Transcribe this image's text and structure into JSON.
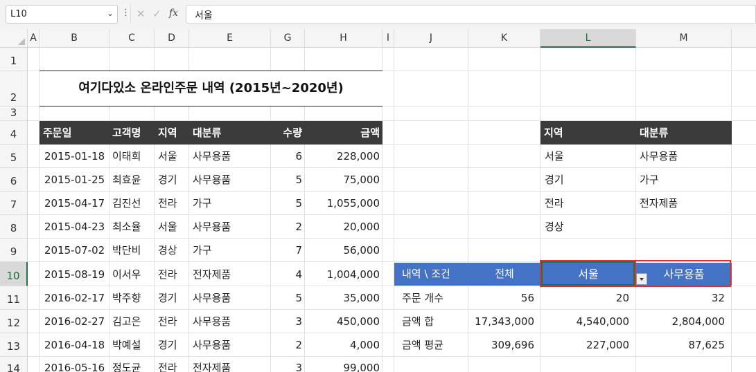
{
  "formula_bar": {
    "name_box": "L10",
    "fx_label": "fx",
    "formula": "서울"
  },
  "columns": [
    {
      "label": "A"
    },
    {
      "label": "B"
    },
    {
      "label": "C"
    },
    {
      "label": "D"
    },
    {
      "label": "E"
    },
    {
      "label": "G"
    },
    {
      "label": "H"
    },
    {
      "label": "I"
    },
    {
      "label": "J"
    },
    {
      "label": "K"
    },
    {
      "label": "L"
    },
    {
      "label": "M"
    }
  ],
  "rows": [
    "1",
    "2",
    "3",
    "4",
    "5",
    "6",
    "7",
    "8",
    "9",
    "10",
    "11",
    "12",
    "13",
    "14"
  ],
  "title": "여기다있소 온라인주문 내역 (2015년~2020년)",
  "orders": {
    "headers": [
      "주문일",
      "고객명",
      "지역",
      "대분류",
      "수량",
      "금액"
    ],
    "rows": [
      [
        "2015-01-18",
        "이태희",
        "서울",
        "사무용품",
        "6",
        "228,000"
      ],
      [
        "2015-01-25",
        "최효윤",
        "경기",
        "사무용품",
        "5",
        "75,000"
      ],
      [
        "2015-04-17",
        "김진선",
        "전라",
        "가구",
        "5",
        "1,055,000"
      ],
      [
        "2015-04-23",
        "최소율",
        "서울",
        "사무용품",
        "2",
        "20,000"
      ],
      [
        "2015-07-02",
        "박단비",
        "경상",
        "가구",
        "7",
        "56,000"
      ],
      [
        "2015-08-19",
        "이서우",
        "전라",
        "전자제품",
        "4",
        "1,004,000"
      ],
      [
        "2016-02-17",
        "박주향",
        "경기",
        "사무용품",
        "5",
        "35,000"
      ],
      [
        "2016-02-27",
        "김고은",
        "전라",
        "사무용품",
        "3",
        "450,000"
      ],
      [
        "2016-04-18",
        "박예설",
        "경기",
        "사무용품",
        "2",
        "4,000"
      ],
      [
        "2016-05-16",
        "정도균",
        "전라",
        "전자제품",
        "3",
        "99,000"
      ]
    ]
  },
  "lists": {
    "region_header": "지역",
    "category_header": "대분류",
    "regions": [
      "서울",
      "경기",
      "전라",
      "경상"
    ],
    "categories": [
      "사무용품",
      "가구",
      "전자제품"
    ]
  },
  "summary": {
    "header": [
      "내역 \\ 조건",
      "전체",
      "서울",
      "사무용품"
    ],
    "rows": [
      [
        "주문 개수",
        "56",
        "20",
        "32"
      ],
      [
        "금액 합",
        "17,343,000",
        "4,540,000",
        "2,804,000"
      ],
      [
        "금액 평균",
        "309,696",
        "227,000",
        "87,625"
      ]
    ]
  },
  "colors": {
    "header_dark": "#3b3b3b",
    "header_blue": "#4472c4",
    "highlight_red": "#e03030",
    "selection_green": "#217346"
  }
}
